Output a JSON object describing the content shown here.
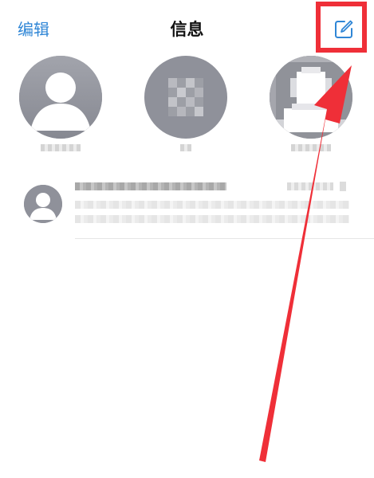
{
  "header": {
    "edit_label": "编辑",
    "title": "信息"
  },
  "icons": {
    "compose": "compose-icon",
    "person": "person-icon"
  },
  "pinned_contacts": [
    {
      "name": "",
      "avatar": "person-icon",
      "obscured": true
    },
    {
      "name": "",
      "avatar": "pixelated-photo",
      "obscured": true
    },
    {
      "name": "",
      "avatar": "person-icon",
      "obscured": true
    }
  ],
  "conversations": [
    {
      "sender": "",
      "time": "",
      "preview": "",
      "avatar": "person-icon",
      "obscured": true
    }
  ],
  "colors": {
    "accent": "#2f86d6",
    "annotation": "#ef2f38",
    "avatar_gray": "#8f919a"
  }
}
